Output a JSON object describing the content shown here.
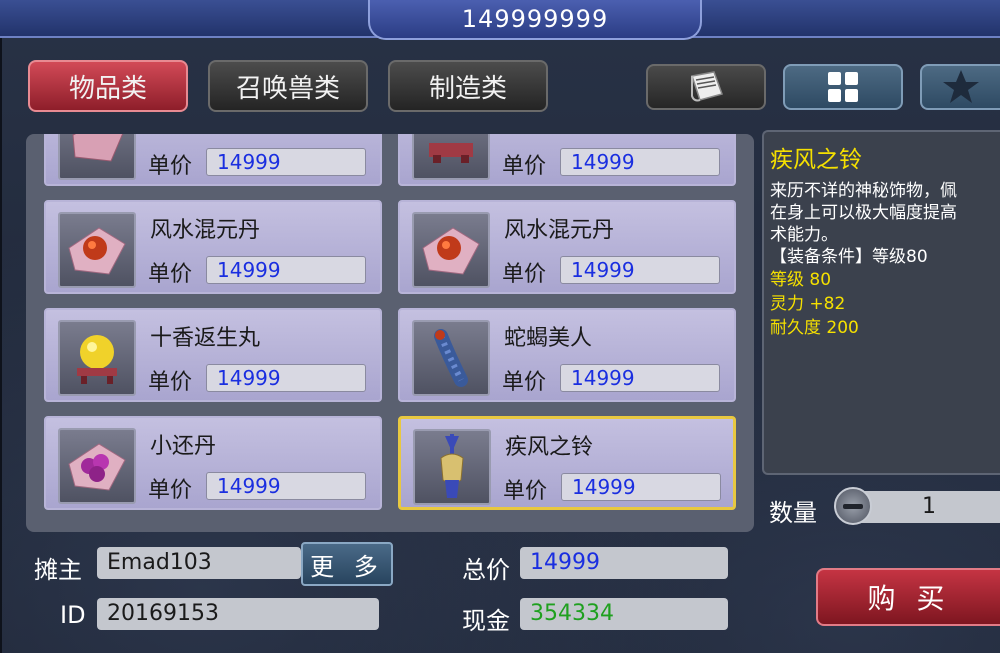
{
  "header": {
    "title": "149999999"
  },
  "tabs": [
    {
      "label": "物品类"
    },
    {
      "label": "召唤兽类"
    },
    {
      "label": "制造类"
    }
  ],
  "icon_buttons": [
    {
      "icon": "scroll-icon"
    },
    {
      "icon": "grid-icon"
    },
    {
      "icon": "star-icon"
    }
  ],
  "items": [
    {
      "name": "",
      "price_label": "单价",
      "price": "14999"
    },
    {
      "name": "",
      "price_label": "单价",
      "price": "14999"
    },
    {
      "name": "风水混元丹",
      "price_label": "单价",
      "price": "14999"
    },
    {
      "name": "风水混元丹",
      "price_label": "单价",
      "price": "14999"
    },
    {
      "name": "十香返生丸",
      "price_label": "单价",
      "price": "14999"
    },
    {
      "name": "蛇蝎美人",
      "price_label": "单价",
      "price": "14999"
    },
    {
      "name": "小还丹",
      "price_label": "单价",
      "price": "14999"
    },
    {
      "name": "疾风之铃",
      "price_label": "单价",
      "price": "14999",
      "selected": true
    }
  ],
  "detail": {
    "title": "疾风之铃",
    "desc_lines": [
      "来历不详的神秘饰物，佩",
      "在身上可以极大幅度提高",
      "术能力。"
    ],
    "requirement": "【装备条件】等级80",
    "stats": [
      "等级 80",
      "灵力 +82",
      "耐久度 200"
    ]
  },
  "quantity": {
    "label": "数量",
    "value": "1"
  },
  "buy_button": {
    "label": "购 买"
  },
  "seller": {
    "label": "摊主",
    "value": "Emad103",
    "more_label": "更 多"
  },
  "id": {
    "label": "ID",
    "value": "20169153"
  },
  "total": {
    "label": "总价",
    "value": "14999"
  },
  "cash": {
    "label": "现金",
    "value": "354334",
    "color": "#1fa01f"
  },
  "colors": {
    "price": "#1a2ee0",
    "detail_title": "#f5e000",
    "selected_border": "#e8c840",
    "active_tab": "#b8323f"
  }
}
